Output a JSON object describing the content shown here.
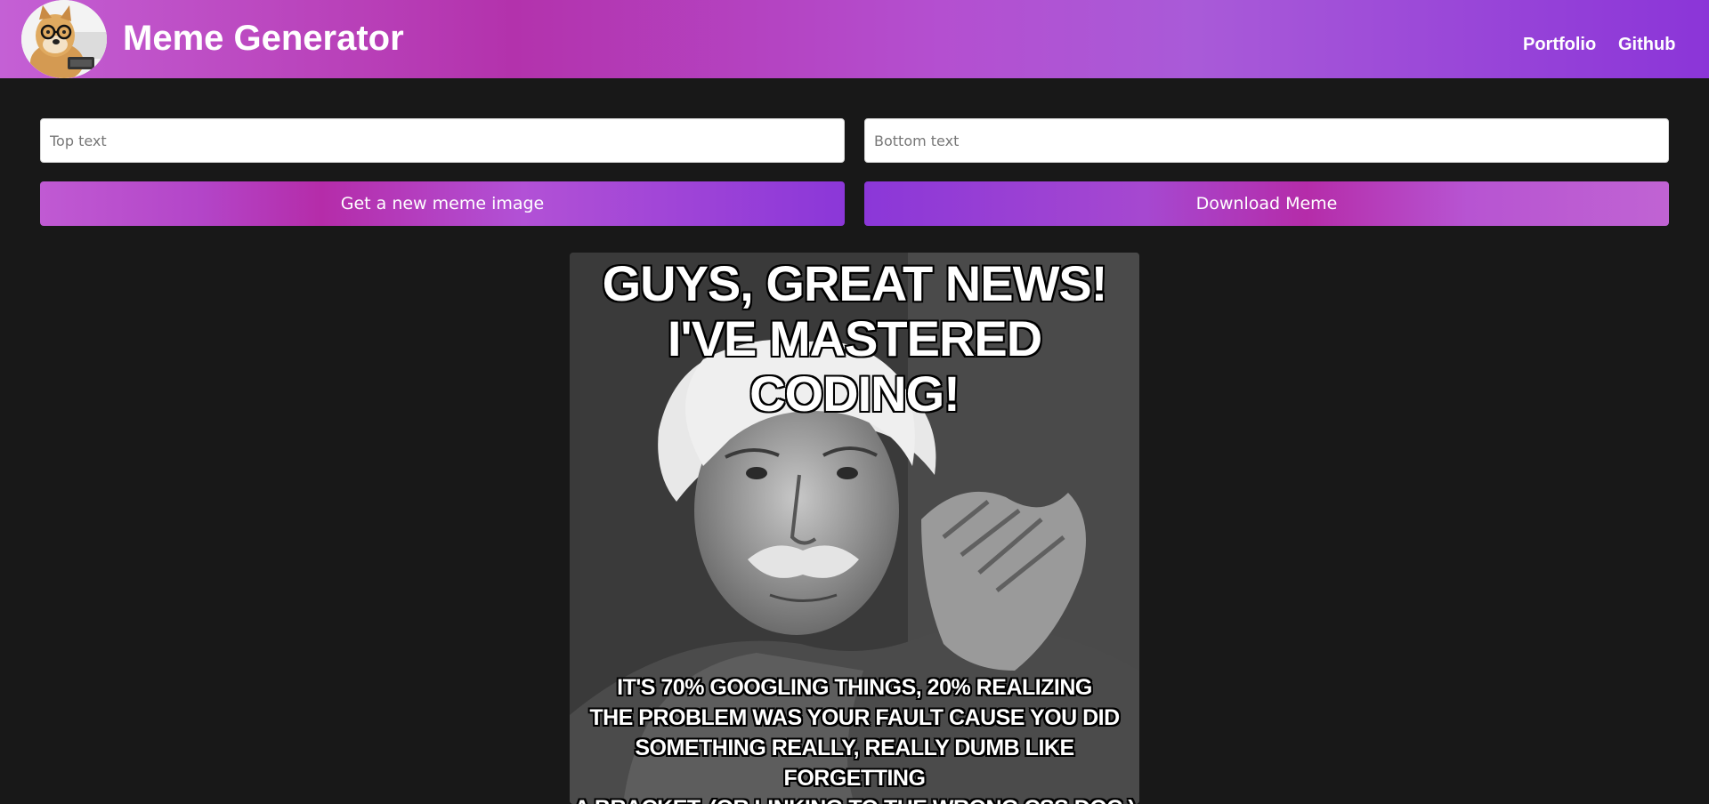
{
  "header": {
    "title": "Meme Generator",
    "logo_icon": "doge-with-glasses-avatar",
    "nav": [
      {
        "label": "Portfolio"
      },
      {
        "label": "Github"
      }
    ],
    "gradient_colors": [
      "#c460d5",
      "#b332ac",
      "#8b35d8"
    ]
  },
  "form": {
    "top_text": {
      "placeholder": "Top text",
      "value": ""
    },
    "bottom_text": {
      "placeholder": "Bottom text",
      "value": ""
    },
    "new_image_label": "Get a new meme image",
    "download_label": "Download Meme"
  },
  "meme": {
    "image_subject": "black-and-white photo of an elderly man with white hair and mustache, hands clasped",
    "top_caption": "GUYS, GREAT NEWS!\nI'VE MASTERED CODING!",
    "bottom_caption": "IT'S 70% GOOGLING THINGS, 20% REALIZING\nTHE PROBLEM WAS YOUR FAULT CAUSE YOU DID\nSOMETHING REALLY, REALLY DUMB LIKE FORGETTING\nA BRACKET. (OR LINKING TO THE WRONG CSS DOC )"
  },
  "colors": {
    "background": "#181818",
    "button_text": "#ffffff"
  }
}
